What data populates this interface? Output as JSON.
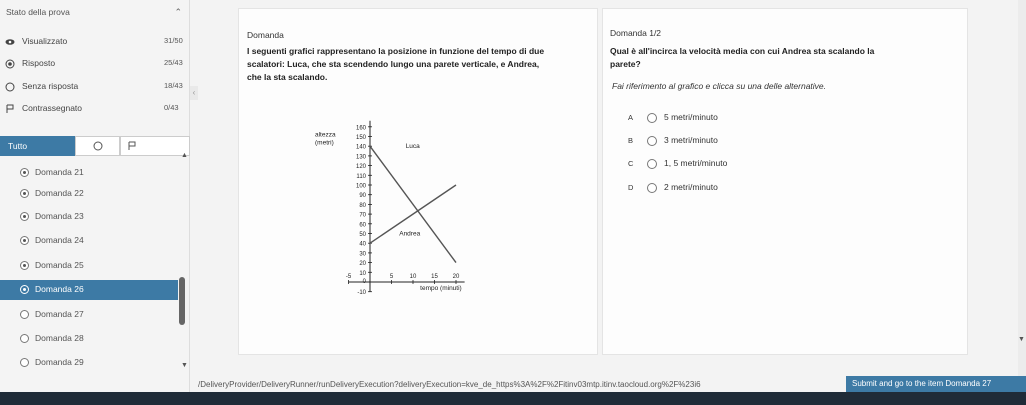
{
  "sidebar": {
    "header": "Stato della prova",
    "stats": [
      {
        "label": "Visualizzato",
        "count": "31/50",
        "icon": "eye-icon"
      },
      {
        "label": "Risposto",
        "count": "25/43",
        "icon": "answered-icon"
      },
      {
        "label": "Senza risposta",
        "count": "18/43",
        "icon": "empty-circle-icon"
      },
      {
        "label": "Contrassegnato",
        "count": "0/43",
        "icon": "flag-icon"
      }
    ],
    "filter_all": "Tutto",
    "items": [
      {
        "label": "Domanda 21",
        "state": "answered"
      },
      {
        "label": "Domanda 22",
        "state": "answered"
      },
      {
        "label": "Domanda 23",
        "state": "answered"
      },
      {
        "label": "Domanda 24",
        "state": "answered"
      },
      {
        "label": "Domanda 25",
        "state": "answered"
      },
      {
        "label": "Domanda 26",
        "state": "active"
      },
      {
        "label": "Domanda 27",
        "state": "empty"
      },
      {
        "label": "Domanda 28",
        "state": "empty"
      },
      {
        "label": "Domanda 29",
        "state": "empty"
      }
    ]
  },
  "question": {
    "title": "Domanda",
    "stem_line1": "I seguenti grafici rappresentano la posizione in funzione del tempo di due",
    "stem_line2": "scalatori: Luca, che sta scendendo lungo una parete verticale, e Andrea,",
    "stem_line3": "che la sta scalando."
  },
  "answer_panel": {
    "title": "Domanda 1/2",
    "question_line1": "Qual è all'incirca la velocità media con cui Andrea sta scalando la",
    "question_line2": "parete?",
    "instruction": "Fai riferimento al grafico e clicca su una delle alternative.",
    "options": [
      {
        "letter": "A",
        "text": "5 metri/minuto"
      },
      {
        "letter": "B",
        "text": "3 metri/minuto"
      },
      {
        "letter": "C",
        "text": "1, 5 metri/minuto"
      },
      {
        "letter": "D",
        "text": "2 metri/minuto"
      }
    ]
  },
  "chart_data": {
    "type": "line",
    "ylabel": "altezza (metri)",
    "xlabel": "tempo (minuti)",
    "xlim": [
      -5,
      22
    ],
    "ylim": [
      -10,
      160
    ],
    "x_ticks": [
      -5,
      0,
      5,
      10,
      15,
      20
    ],
    "y_ticks": [
      -10,
      0,
      10,
      20,
      30,
      40,
      50,
      60,
      70,
      80,
      90,
      100,
      110,
      120,
      130,
      140,
      150,
      160
    ],
    "series": [
      {
        "name": "Luca",
        "x": [
          0,
          20
        ],
        "y": [
          140,
          20
        ]
      },
      {
        "name": "Andrea",
        "x": [
          0,
          20
        ],
        "y": [
          40,
          100
        ]
      }
    ]
  },
  "footer": {
    "url": "/DeliveryProvider/DeliveryRunner/runDeliveryExecution?deliveryExecution=kve_de_https%3A%2F%2Fitinv03mtp.itinv.taocloud.org%2F%23i6",
    "submit_label": "Submit and go to the item Domanda 27"
  }
}
